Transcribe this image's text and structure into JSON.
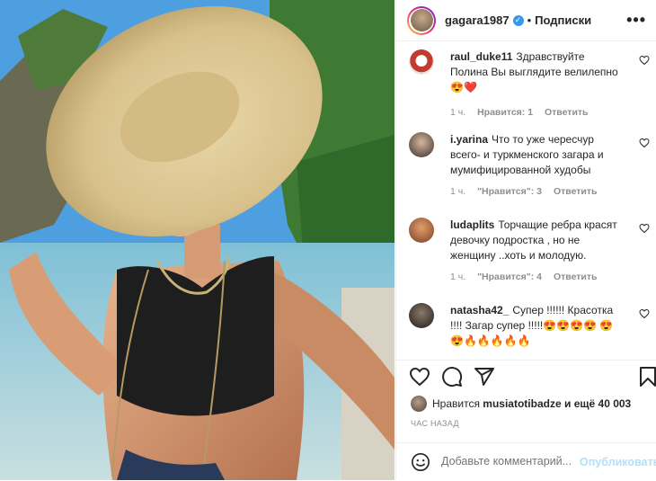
{
  "header": {
    "username": "gagara1987",
    "verified_mark": "✓",
    "separator": "•",
    "follow_label": "Подписки",
    "more_label": "•••"
  },
  "comments": [
    {
      "user": "raul_duke11",
      "text": "Здравствуйте Полина Вы выглядите велилепно 😍❤️",
      "time": "1 ч.",
      "likes": "Нравится: 1",
      "reply": "Ответить"
    },
    {
      "user": "i.yarina",
      "text": "Что то уже чересчур всего- и туркменского загара и мумифицированной худобы",
      "time": "1 ч.",
      "likes": "\"Нравится\": 3",
      "reply": "Ответить"
    },
    {
      "user": "ludaplits",
      "text": "Торчащие ребра красят девочку подростка , но не женщину ..хоть и молодую.",
      "time": "1 ч.",
      "likes": "\"Нравится\": 4",
      "reply": "Ответить"
    },
    {
      "user": "natasha42_",
      "text": "Супер !!!!!! Красотка !!!! Загар супер !!!!!😍😍😍😍 😍😍🔥🔥🔥🔥🔥",
      "time": "",
      "likes": "",
      "reply": ""
    }
  ],
  "likes": {
    "prefix": "Нравится",
    "user": "musiatotibadze",
    "suffix": "и ещё 40 003"
  },
  "date": "ЧАС НАЗАД",
  "add_comment": {
    "placeholder": "Добавьте комментарий...",
    "publish_label": "Опубликовать"
  },
  "icons": {
    "more": "more-icon",
    "like": "heart-icon",
    "comment": "comment-icon",
    "share": "share-icon",
    "save": "bookmark-icon",
    "emoji": "smile-icon"
  },
  "colors": {
    "link": "#3897f0",
    "publish_disabled": "#b2dffc",
    "meta": "#8e8e8e",
    "text": "#262626"
  }
}
